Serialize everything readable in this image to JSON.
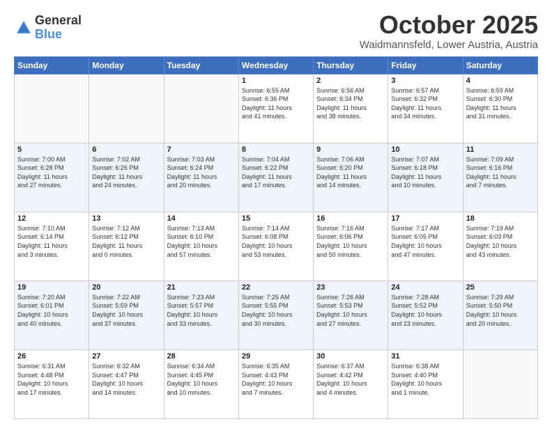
{
  "header": {
    "logo_general": "General",
    "logo_blue": "Blue",
    "month_title": "October 2025",
    "location": "Waidmannsfeld, Lower Austria, Austria"
  },
  "weekdays": [
    "Sunday",
    "Monday",
    "Tuesday",
    "Wednesday",
    "Thursday",
    "Friday",
    "Saturday"
  ],
  "weeks": [
    [
      {
        "day": "",
        "info": ""
      },
      {
        "day": "",
        "info": ""
      },
      {
        "day": "",
        "info": ""
      },
      {
        "day": "1",
        "info": "Sunrise: 6:55 AM\nSunset: 6:36 PM\nDaylight: 11 hours\nand 41 minutes."
      },
      {
        "day": "2",
        "info": "Sunrise: 6:56 AM\nSunset: 6:34 PM\nDaylight: 11 hours\nand 38 minutes."
      },
      {
        "day": "3",
        "info": "Sunrise: 6:57 AM\nSunset: 6:32 PM\nDaylight: 11 hours\nand 34 minutes."
      },
      {
        "day": "4",
        "info": "Sunrise: 6:59 AM\nSunset: 6:30 PM\nDaylight: 11 hours\nand 31 minutes."
      }
    ],
    [
      {
        "day": "5",
        "info": "Sunrise: 7:00 AM\nSunset: 6:28 PM\nDaylight: 11 hours\nand 27 minutes."
      },
      {
        "day": "6",
        "info": "Sunrise: 7:02 AM\nSunset: 6:26 PM\nDaylight: 11 hours\nand 24 minutes."
      },
      {
        "day": "7",
        "info": "Sunrise: 7:03 AM\nSunset: 6:24 PM\nDaylight: 11 hours\nand 20 minutes."
      },
      {
        "day": "8",
        "info": "Sunrise: 7:04 AM\nSunset: 6:22 PM\nDaylight: 11 hours\nand 17 minutes."
      },
      {
        "day": "9",
        "info": "Sunrise: 7:06 AM\nSunset: 6:20 PM\nDaylight: 11 hours\nand 14 minutes."
      },
      {
        "day": "10",
        "info": "Sunrise: 7:07 AM\nSunset: 6:18 PM\nDaylight: 11 hours\nand 10 minutes."
      },
      {
        "day": "11",
        "info": "Sunrise: 7:09 AM\nSunset: 6:16 PM\nDaylight: 11 hours\nand 7 minutes."
      }
    ],
    [
      {
        "day": "12",
        "info": "Sunrise: 7:10 AM\nSunset: 6:14 PM\nDaylight: 11 hours\nand 3 minutes."
      },
      {
        "day": "13",
        "info": "Sunrise: 7:12 AM\nSunset: 6:12 PM\nDaylight: 11 hours\nand 0 minutes."
      },
      {
        "day": "14",
        "info": "Sunrise: 7:13 AM\nSunset: 6:10 PM\nDaylight: 10 hours\nand 57 minutes."
      },
      {
        "day": "15",
        "info": "Sunrise: 7:14 AM\nSunset: 6:08 PM\nDaylight: 10 hours\nand 53 minutes."
      },
      {
        "day": "16",
        "info": "Sunrise: 7:16 AM\nSunset: 6:06 PM\nDaylight: 10 hours\nand 50 minutes."
      },
      {
        "day": "17",
        "info": "Sunrise: 7:17 AM\nSunset: 6:05 PM\nDaylight: 10 hours\nand 47 minutes."
      },
      {
        "day": "18",
        "info": "Sunrise: 7:19 AM\nSunset: 6:03 PM\nDaylight: 10 hours\nand 43 minutes."
      }
    ],
    [
      {
        "day": "19",
        "info": "Sunrise: 7:20 AM\nSunset: 6:01 PM\nDaylight: 10 hours\nand 40 minutes."
      },
      {
        "day": "20",
        "info": "Sunrise: 7:22 AM\nSunset: 5:59 PM\nDaylight: 10 hours\nand 37 minutes."
      },
      {
        "day": "21",
        "info": "Sunrise: 7:23 AM\nSunset: 5:57 PM\nDaylight: 10 hours\nand 33 minutes."
      },
      {
        "day": "22",
        "info": "Sunrise: 7:25 AM\nSunset: 5:55 PM\nDaylight: 10 hours\nand 30 minutes."
      },
      {
        "day": "23",
        "info": "Sunrise: 7:26 AM\nSunset: 5:53 PM\nDaylight: 10 hours\nand 27 minutes."
      },
      {
        "day": "24",
        "info": "Sunrise: 7:28 AM\nSunset: 5:52 PM\nDaylight: 10 hours\nand 23 minutes."
      },
      {
        "day": "25",
        "info": "Sunrise: 7:29 AM\nSunset: 5:50 PM\nDaylight: 10 hours\nand 20 minutes."
      }
    ],
    [
      {
        "day": "26",
        "info": "Sunrise: 6:31 AM\nSunset: 4:48 PM\nDaylight: 10 hours\nand 17 minutes."
      },
      {
        "day": "27",
        "info": "Sunrise: 6:32 AM\nSunset: 4:47 PM\nDaylight: 10 hours\nand 14 minutes."
      },
      {
        "day": "28",
        "info": "Sunrise: 6:34 AM\nSunset: 4:45 PM\nDaylight: 10 hours\nand 10 minutes."
      },
      {
        "day": "29",
        "info": "Sunrise: 6:35 AM\nSunset: 4:43 PM\nDaylight: 10 hours\nand 7 minutes."
      },
      {
        "day": "30",
        "info": "Sunrise: 6:37 AM\nSunset: 4:42 PM\nDaylight: 10 hours\nand 4 minutes."
      },
      {
        "day": "31",
        "info": "Sunrise: 6:38 AM\nSunset: 4:40 PM\nDaylight: 10 hours\nand 1 minute."
      },
      {
        "day": "",
        "info": ""
      }
    ]
  ]
}
